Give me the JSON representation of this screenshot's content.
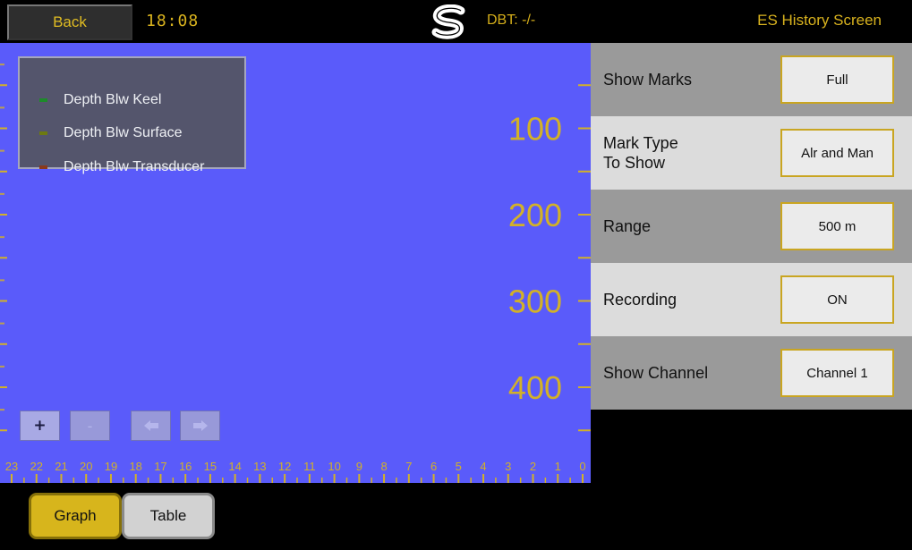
{
  "topbar": {
    "back_label": "Back",
    "time": "18:08",
    "logo_letter": "S",
    "dbt_text": "DBT: -/-",
    "screen_title": "ES History Screen"
  },
  "legend": {
    "items": [
      {
        "label": "Depth Blw Keel",
        "color": "#1d8a2a"
      },
      {
        "label": "Depth Blw Surface",
        "color": "#6d7a10"
      },
      {
        "label": "Depth Blw Transducer",
        "color": "#8a3a1c"
      }
    ]
  },
  "chart_data": {
    "type": "line",
    "y_axis": {
      "tick_labels": [
        "100",
        "200",
        "300",
        "400"
      ],
      "ylim": [
        0,
        500
      ],
      "inverted": true
    },
    "x_axis": {
      "tick_labels": [
        "23",
        "22",
        "21",
        "20",
        "19",
        "18",
        "17",
        "16",
        "15",
        "14",
        "13",
        "12",
        "11",
        "10",
        "9",
        "8",
        "7",
        "6",
        "5",
        "4",
        "3",
        "2",
        "1",
        "0"
      ]
    },
    "series": [
      {
        "name": "Depth Blw Keel",
        "values": []
      },
      {
        "name": "Depth Blw Surface",
        "values": []
      },
      {
        "name": "Depth Blw Transducer",
        "values": []
      }
    ],
    "background": "#5a5bfa",
    "tick_color": "#d2b128"
  },
  "chart_controls": {
    "zoom_in": "+",
    "zoom_out": "-"
  },
  "settings": [
    {
      "label": "Show Marks",
      "value": "Full"
    },
    {
      "label": "Mark Type\nTo Show",
      "value": "Alr and Man"
    },
    {
      "label": "Range",
      "value": "500 m"
    },
    {
      "label": "Recording",
      "value": "ON"
    },
    {
      "label": "Show Channel",
      "value": "Channel 1"
    }
  ],
  "view_tabs": {
    "graph_label": "Graph",
    "table_label": "Table",
    "active": "Graph"
  },
  "colors": {
    "accent": "#d7b51c",
    "chart_bg": "#5a5bfa"
  }
}
